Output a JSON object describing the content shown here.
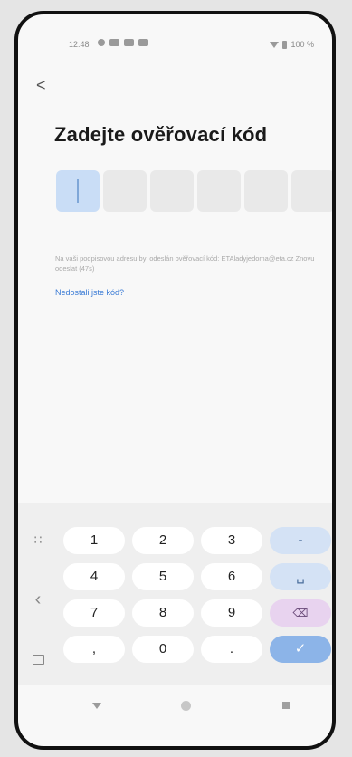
{
  "status_bar": {
    "time": "12:48",
    "battery": "100 %",
    "icons": [
      "notification-icon",
      "notification-icon",
      "mail-icon",
      "calendar-icon"
    ]
  },
  "header": {
    "back_label": "<",
    "title": "Zadejte ověřovací kód"
  },
  "code_input": {
    "length": 6,
    "filled": 0
  },
  "info": {
    "text": "Na vaši podpisovou adresu byl odeslán ověřovací kód: ETAladyjedoma@eta.cz Znovu odeslat (47s)"
  },
  "resend": {
    "label": "Nedostali jste kód?"
  },
  "keyboard": {
    "rows": [
      [
        "1",
        "2",
        "3",
        "-"
      ],
      [
        "4",
        "5",
        "6",
        "␣"
      ],
      [
        "7",
        "8",
        "9",
        "⌫"
      ],
      [
        ",",
        "0",
        ".",
        "✓"
      ]
    ],
    "colors": {
      "action": "#d4e2f5",
      "backspace": "#e8d3ef",
      "enter": "#8cb4e8"
    }
  },
  "nav_bar": {
    "icons": [
      "nav-back-icon",
      "nav-home-icon",
      "nav-recent-icon"
    ]
  }
}
